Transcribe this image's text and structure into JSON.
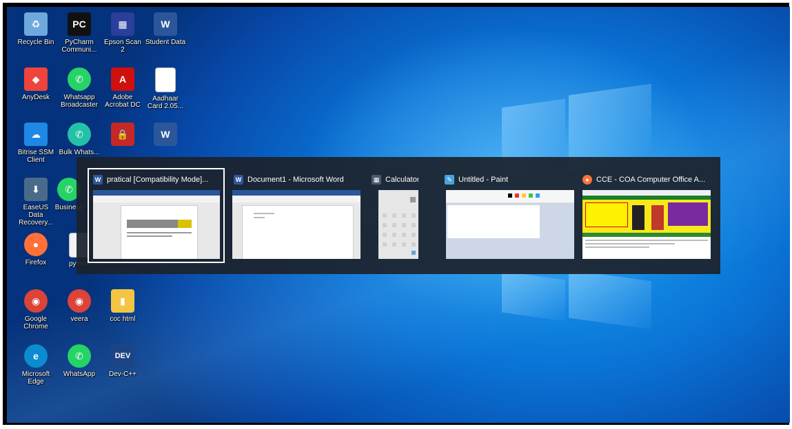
{
  "desktop_icons": [
    {
      "label": "Recycle Bin",
      "icon": "recycle-bin-icon",
      "color": "#6fa8dc",
      "glyph": "♻"
    },
    {
      "label": "PyCharm Communi...",
      "icon": "pycharm-icon",
      "color": "#111111",
      "glyph": "PC"
    },
    {
      "label": "Epson Scan 2",
      "icon": "epson-scan-icon",
      "color": "#2a3e9c",
      "glyph": "▦"
    },
    {
      "label": "Student Data",
      "icon": "word-doc-icon",
      "color": "#2b579a",
      "glyph": "W"
    },
    {
      "label": "AnyDesk",
      "icon": "anydesk-icon",
      "color": "#ef443b",
      "glyph": "◆"
    },
    {
      "label": "Whatsapp Broadcaster",
      "icon": "whatsapp-icon",
      "color": "#25d366",
      "glyph": "✆"
    },
    {
      "label": "Adobe Acrobat DC",
      "icon": "adobe-acrobat-icon",
      "color": "#d00f0f",
      "glyph": "A"
    },
    {
      "label": "Aadhaar Card 2.05...",
      "icon": "file-icon",
      "color": "#ffffff",
      "glyph": ""
    },
    {
      "label": "Bitrise SSM Client",
      "icon": "cloud-icon",
      "color": "#1e88e5",
      "glyph": "☁"
    },
    {
      "label": "Bulk Whats...",
      "icon": "whatsapp-icon",
      "color": "#23c1a8",
      "glyph": "✆"
    },
    {
      "label": "",
      "icon": "file-locker-icon",
      "color": "#c62828",
      "glyph": "🔒"
    },
    {
      "label": "",
      "icon": "word-doc-icon",
      "color": "#2b579a",
      "glyph": "W"
    },
    {
      "label": "EaseUS Data Recovery...",
      "icon": "easeus-icon",
      "color": "#4a6a8a",
      "glyph": "⬇"
    },
    {
      "label": "Business",
      "icon": "whatsapp-business-icon",
      "color": "#25d366",
      "glyph": "✆"
    },
    {
      "label": "Firefox",
      "icon": "firefox-icon",
      "color": "#ff7139",
      "glyph": "●"
    },
    {
      "label": "python",
      "icon": "text-file-icon",
      "color": "#f2f2f2",
      "glyph": ""
    },
    {
      "label": "Google Chrome",
      "icon": "chrome-icon",
      "color": "#db4437",
      "glyph": "◉"
    },
    {
      "label": "veera",
      "icon": "chrome-icon",
      "color": "#db4437",
      "glyph": "◉"
    },
    {
      "label": "coc html",
      "icon": "zip-folder-icon",
      "color": "#f4c542",
      "glyph": "▮"
    },
    {
      "label": "Microsoft Edge",
      "icon": "edge-icon",
      "color": "#0c8bd1",
      "glyph": "e"
    },
    {
      "label": "WhatsApp",
      "icon": "whatsapp-icon",
      "color": "#25d366",
      "glyph": "✆"
    },
    {
      "label": "Dev-C++",
      "icon": "devcpp-icon",
      "color": "#1c4587",
      "glyph": "DEV"
    }
  ],
  "task_switcher": {
    "windows": [
      {
        "title": "pratical [Compatibility Mode]...",
        "app_icon": "word-icon",
        "color": "#2b579a",
        "glyph": "W",
        "selected": true
      },
      {
        "title": "Document1 - Microsoft Word",
        "app_icon": "word-icon",
        "color": "#2b579a",
        "glyph": "W",
        "selected": false
      },
      {
        "title": "Calculator",
        "app_icon": "calculator-icon",
        "color": "#4a5a6a",
        "glyph": "▦",
        "selected": false
      },
      {
        "title": "Untitled - Paint",
        "app_icon": "paint-icon",
        "color": "#4aa3df",
        "glyph": "🎨",
        "selected": false
      },
      {
        "title": "CCE - COA Computer Office A...",
        "app_icon": "firefox-icon",
        "color": "#ff7139",
        "glyph": "●",
        "selected": false
      }
    ]
  }
}
